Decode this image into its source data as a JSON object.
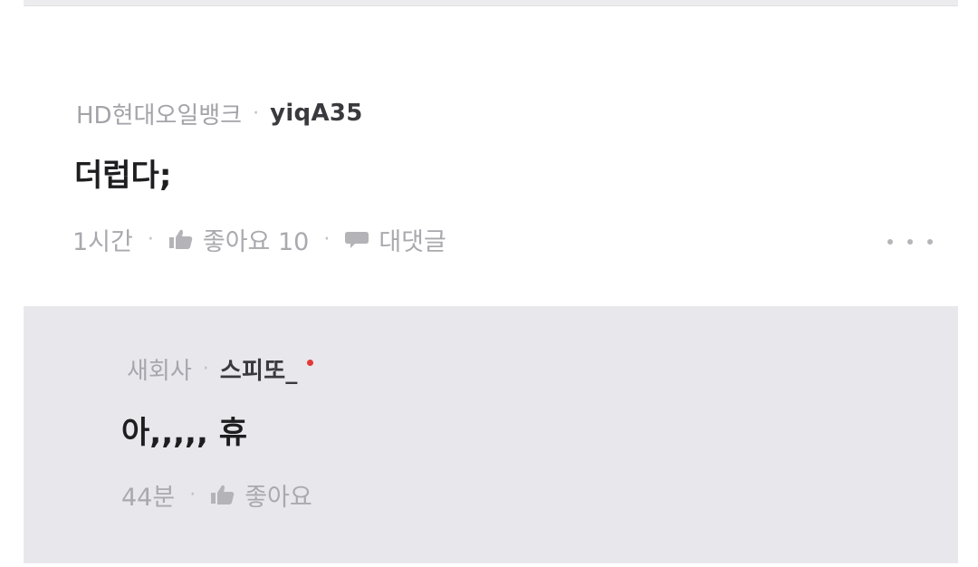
{
  "comment": {
    "company": "HD현대오일뱅크",
    "separator": "·",
    "author": "yiqA35",
    "body": "더럽다;",
    "time": "1시간",
    "like_label": "좋아요 10",
    "reply_label": "대댓글",
    "more_icon": "more-dots-icon",
    "like_icon": "thumbs-up-icon",
    "reply_icon": "speech-bubble-icon"
  },
  "reply": {
    "company": "새회사",
    "separator": "·",
    "author": "스피또_",
    "body": "아,,,,, 휴",
    "time": "44분",
    "like_label": "좋아요",
    "badge_color": "#e53935"
  }
}
